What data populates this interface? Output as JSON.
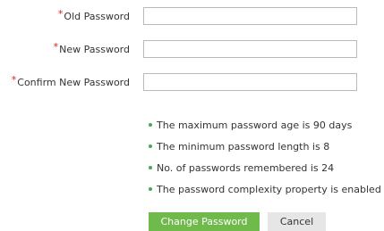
{
  "form": {
    "required_marker": "*",
    "old_password": {
      "label": "Old Password",
      "value": ""
    },
    "new_password": {
      "label": "New Password",
      "value": ""
    },
    "confirm_password": {
      "label": "Confirm New Password",
      "value": ""
    }
  },
  "policy_rules": [
    "The maximum password age is 90 days",
    "The minimum password length is 8",
    "No. of passwords remembered is 24",
    "The password complexity property is enabled"
  ],
  "buttons": {
    "change_password": "Change Password",
    "cancel": "Cancel"
  },
  "colors": {
    "required": "#e01b1b",
    "primary_button": "#6fba4a",
    "bullet": "#4ea64e",
    "secondary_button": "#e6e6e6"
  }
}
